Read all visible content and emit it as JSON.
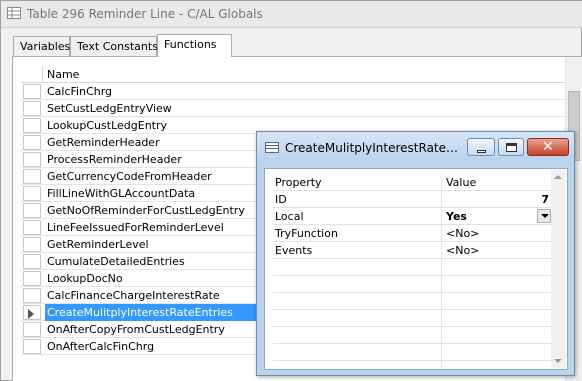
{
  "window": {
    "title": "Table 296 Reminder Line - C/AL Globals"
  },
  "tabs": [
    {
      "label": "Variables"
    },
    {
      "label": "Text Constants"
    },
    {
      "label": "Functions"
    }
  ],
  "grid": {
    "column_name": "Name",
    "rows": [
      {
        "name": "CalcFinChrg"
      },
      {
        "name": "SetCustLedgEntryView"
      },
      {
        "name": "LookupCustLedgEntry"
      },
      {
        "name": "GetReminderHeader"
      },
      {
        "name": "ProcessReminderHeader"
      },
      {
        "name": "GetCurrencyCodeFromHeader"
      },
      {
        "name": "FillLineWithGLAccountData"
      },
      {
        "name": "GetNoOfReminderForCustLedgEntry"
      },
      {
        "name": "LineFeeIssuedForReminderLevel"
      },
      {
        "name": "GetReminderLevel"
      },
      {
        "name": "CumulateDetailedEntries"
      },
      {
        "name": "LookupDocNo"
      },
      {
        "name": "CalcFinanceChargeInterestRate"
      },
      {
        "name": "CreateMulitplyInterestRateEntries"
      },
      {
        "name": "OnAfterCopyFromCustLedgEntry"
      },
      {
        "name": "OnAfterCalcFinChrg"
      }
    ]
  },
  "properties_window": {
    "title": "CreateMulitplyInterestRateEntri...",
    "column_property": "Property",
    "column_value": "Value",
    "rows": [
      {
        "property": "ID",
        "value": "7"
      },
      {
        "property": "Local",
        "value": "Yes"
      },
      {
        "property": "TryFunction",
        "value": "<No>"
      },
      {
        "property": "Events",
        "value": "<No>"
      }
    ]
  },
  "colors": {
    "selection": "#3399ff",
    "close_button": "#c7402a",
    "properties_frame": "#bcd3ec"
  }
}
